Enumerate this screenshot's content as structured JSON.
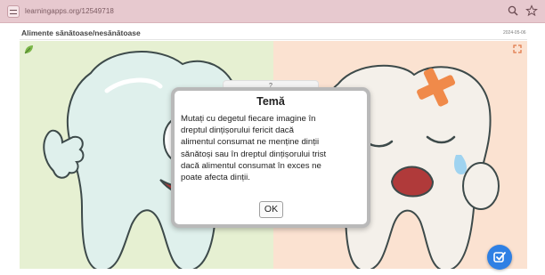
{
  "browser": {
    "url": "learningapps.org/12549718",
    "icons": [
      "tune-icon",
      "zoom-icon",
      "star-icon"
    ]
  },
  "app": {
    "title": "Alimente sănătoase/nesănătoase",
    "date": "2024-05-06"
  },
  "stage": {
    "left_color": "#e6f0d2",
    "right_color": "#fbe2d1",
    "hidden_card_label": "?"
  },
  "modal": {
    "title": "Temă",
    "lines": [
      "Mutați cu degetul fiecare imagine în",
      "dreptul dințișorului fericit dacă",
      "alimentul consumat ne menține dinții",
      "sănătoși sau în dreptul dințișorului trist",
      "dacă alimentul consumat în exces ne",
      "poate afecta dinții."
    ],
    "ok_label": "OK"
  },
  "colors": {
    "accent": "#2f80e4",
    "browser_bar": "#e7c9cf"
  }
}
